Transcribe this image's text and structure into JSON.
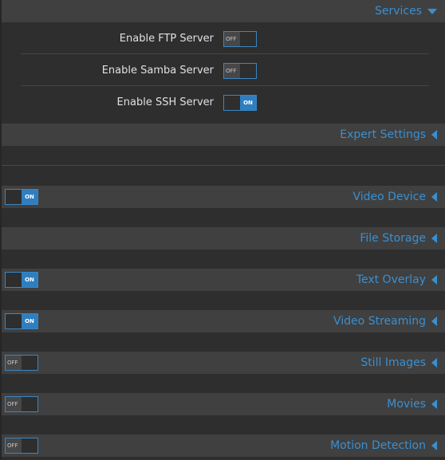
{
  "services": {
    "title": "Services",
    "expanded": true,
    "items": [
      {
        "label": "Enable FTP Server",
        "state": "OFF"
      },
      {
        "label": "Enable Samba Server",
        "state": "OFF"
      },
      {
        "label": "Enable SSH Server",
        "state": "ON"
      }
    ]
  },
  "sections": [
    {
      "title": "Expert Settings"
    },
    {
      "title": "Video Device",
      "toggle": "ON"
    },
    {
      "title": "File Storage"
    },
    {
      "title": "Text Overlay",
      "toggle": "ON"
    },
    {
      "title": "Video Streaming",
      "toggle": "ON"
    },
    {
      "title": "Still Images",
      "toggle": "OFF"
    },
    {
      "title": "Movies",
      "toggle": "OFF"
    },
    {
      "title": "Motion Detection",
      "toggle": "OFF"
    }
  ],
  "toggle_labels": {
    "on": "ON",
    "off": "OFF"
  },
  "colors": {
    "accent": "#3a8fd0",
    "header_bg": "#404040",
    "page_bg": "#2e2e2e"
  }
}
